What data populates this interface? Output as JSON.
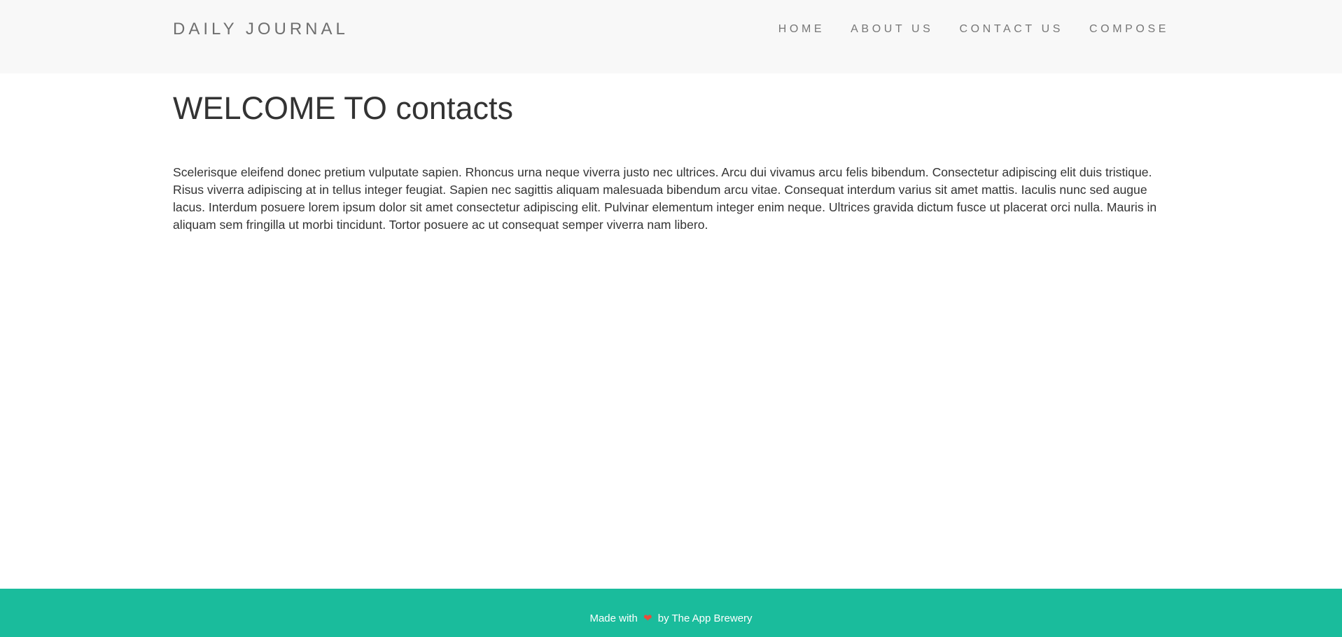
{
  "navbar": {
    "brand": "DAILY JOURNAL",
    "links": [
      "HOME",
      "ABOUT US",
      "CONTACT US",
      "COMPOSE"
    ]
  },
  "main": {
    "title": "WELCOME TO contacts",
    "body": "Scelerisque eleifend donec pretium vulputate sapien. Rhoncus urna neque viverra justo nec ultrices. Arcu dui vivamus arcu felis bibendum. Consectetur adipiscing elit duis tristique. Risus viverra adipiscing at in tellus integer feugiat. Sapien nec sagittis aliquam malesuada bibendum arcu vitae. Consequat interdum varius sit amet mattis. Iaculis nunc sed augue lacus. Interdum posuere lorem ipsum dolor sit amet consectetur adipiscing elit. Pulvinar elementum integer enim neque. Ultrices gravida dictum fusce ut placerat orci nulla. Mauris in aliquam sem fringilla ut morbi tincidunt. Tortor posuere ac ut consequat semper viverra nam libero."
  },
  "footer": {
    "prefix": "Made with",
    "icon": "heart-icon",
    "suffix": "by The App Brewery"
  },
  "colors": {
    "navbar_bg": "#f8f8f8",
    "footer_bg": "#1abc9c",
    "heart": "#e74c3c",
    "text": "#333333"
  }
}
